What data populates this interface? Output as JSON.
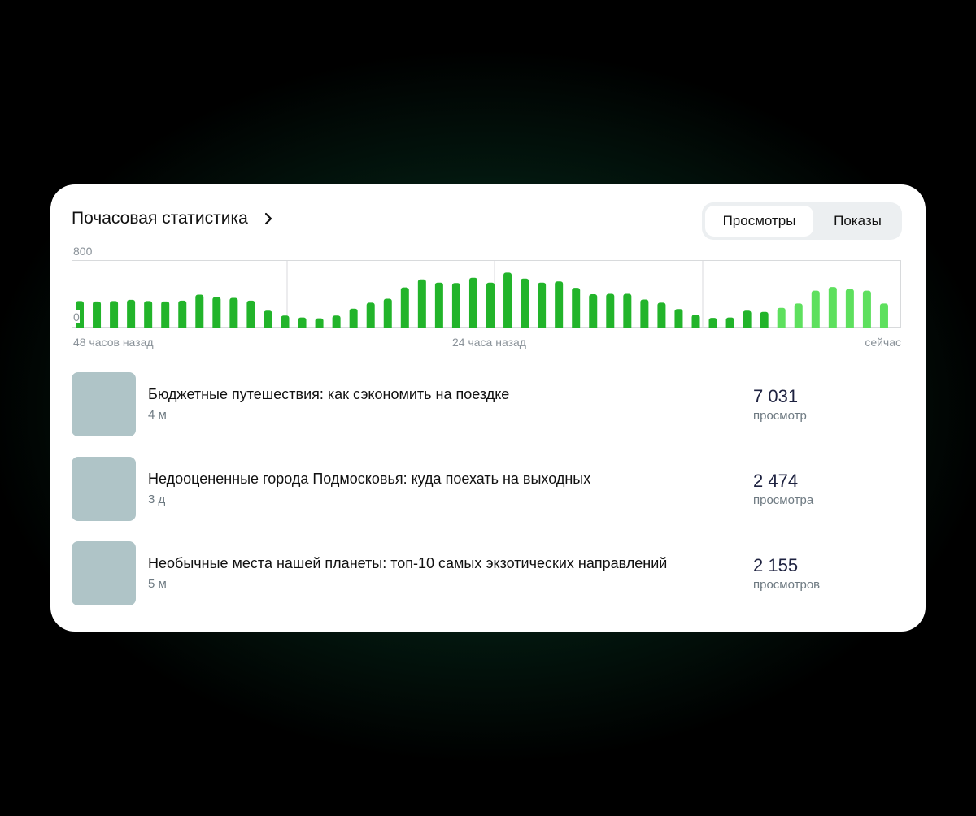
{
  "header": {
    "title": "Почасовая статистика",
    "tabs": [
      {
        "label": "Просмотры",
        "active": true
      },
      {
        "label": "Показы",
        "active": false
      }
    ]
  },
  "chart_data": {
    "type": "bar",
    "title": "Почасовая статистика",
    "ylim": [
      0,
      800
    ],
    "ytick_labels": [
      "800",
      "0"
    ],
    "x_tick_labels": [
      "48 часов назад",
      "24 часа назад",
      "сейчас"
    ],
    "grid": "vertical lines at 48h, 24h, 12h and now",
    "colors": {
      "past": "#22b42a",
      "recent": "#5ee05e",
      "grid": "#d8dadc"
    },
    "values": [
      330,
      325,
      330,
      345,
      330,
      325,
      335,
      410,
      380,
      370,
      335,
      210,
      150,
      125,
      115,
      150,
      235,
      310,
      360,
      500,
      600,
      560,
      555,
      620,
      560,
      685,
      610,
      560,
      575,
      495,
      415,
      420,
      420,
      350,
      310,
      230,
      160,
      120,
      125,
      210,
      195,
      245,
      300,
      460,
      505,
      480,
      460,
      300
    ],
    "recent_from_index": 41
  },
  "articles": [
    {
      "title": "Бюджетные путешествия: как сэкономить на поездке",
      "age": "4 м",
      "value": "7 031",
      "unit": "просмотр"
    },
    {
      "title": "Недооцененные города Подмосковья: куда поехать на выходных",
      "age": "3 д",
      "value": "2 474",
      "unit": "просмотра"
    },
    {
      "title": "Необычные места нашей планеты: топ-10 самых экзотических направлений",
      "age": "5 м",
      "value": "2 155",
      "unit": "просмотров"
    }
  ]
}
